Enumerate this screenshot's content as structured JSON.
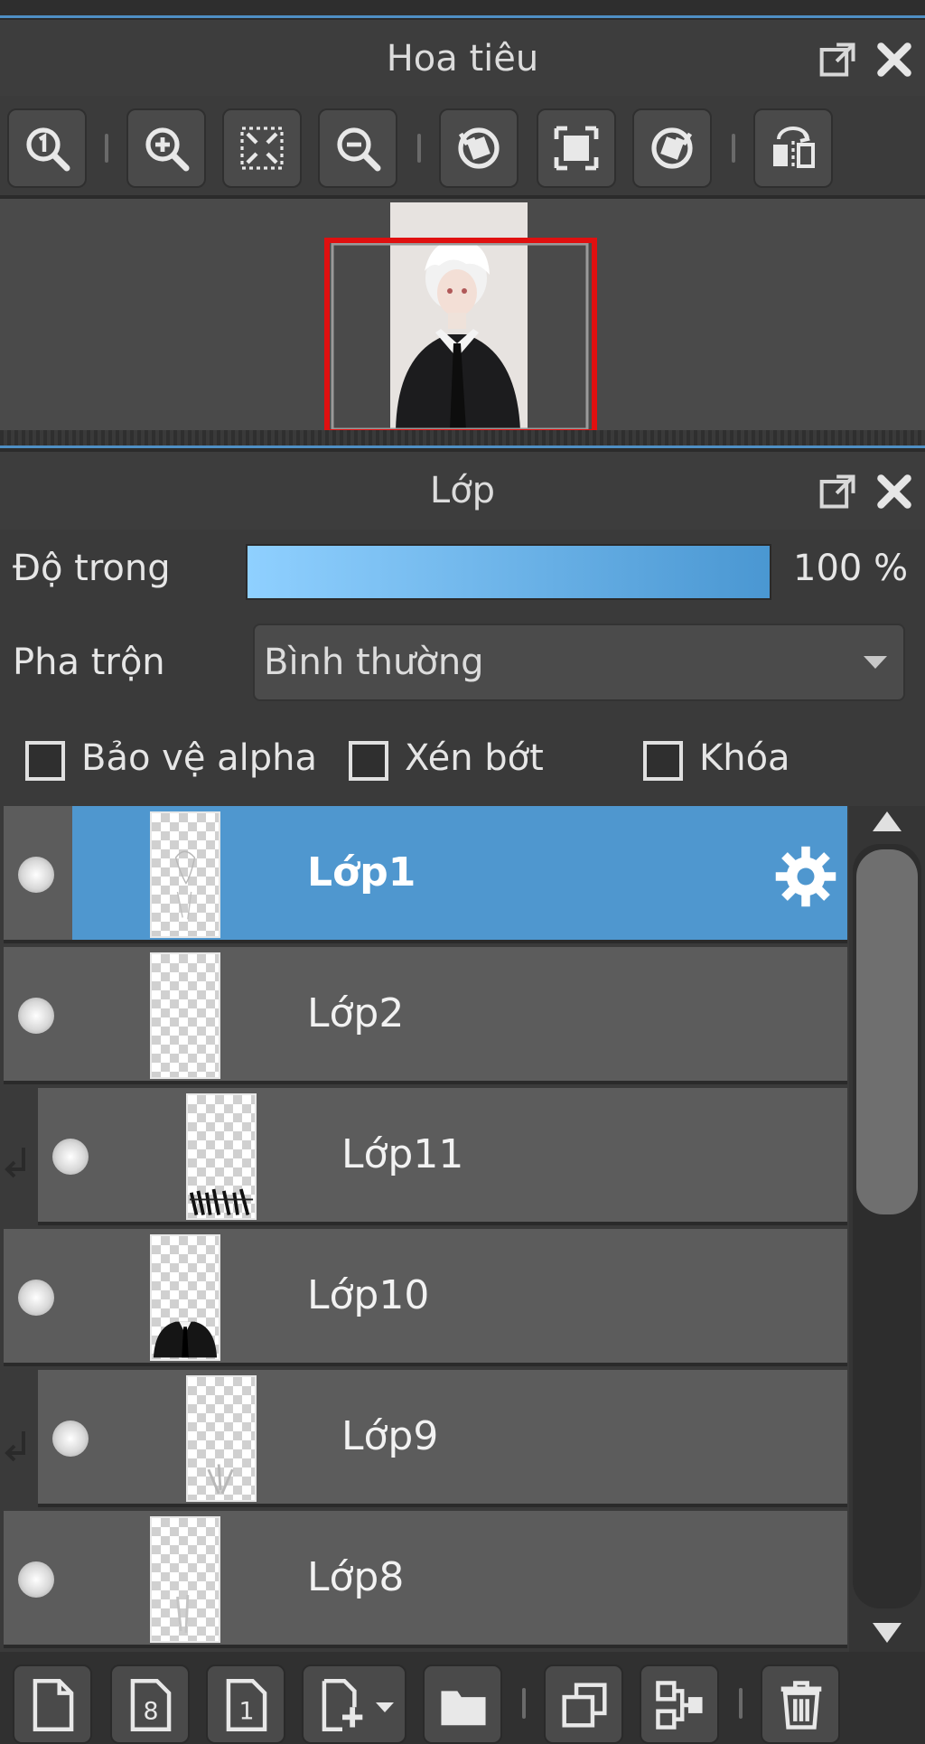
{
  "navigator": {
    "title": "Hoa tiêu",
    "toolbar": [
      {
        "name": "zoom-actual-size-icon"
      },
      {
        "name": "zoom-in-icon"
      },
      {
        "name": "fit-to-window-icon"
      },
      {
        "name": "zoom-out-icon"
      },
      {
        "name": "rotate-left-icon"
      },
      {
        "name": "fit-screen-icon"
      },
      {
        "name": "rotate-right-icon"
      },
      {
        "name": "flip-horizontal-icon"
      }
    ]
  },
  "layers_panel": {
    "title": "Lớp",
    "opacity_label": "Độ trong",
    "opacity_value": "100 %",
    "opacity_fraction": 1.0,
    "blend_label": "Pha trộn",
    "blend_mode": "Bình thường",
    "checkboxes": [
      {
        "label": "Bảo vệ alpha",
        "checked": false
      },
      {
        "label": "Xén bớt",
        "checked": false
      },
      {
        "label": "Khóa",
        "checked": false
      }
    ],
    "layers": [
      {
        "name": "Lớp1",
        "selected": true,
        "clipped": false
      },
      {
        "name": "Lớp2",
        "selected": false,
        "clipped": false
      },
      {
        "name": "Lớp11",
        "selected": false,
        "clipped": true
      },
      {
        "name": "Lớp10",
        "selected": false,
        "clipped": false
      },
      {
        "name": "Lớp9",
        "selected": false,
        "clipped": true
      },
      {
        "name": "Lớp8",
        "selected": false,
        "clipped": false
      }
    ],
    "bottom_toolbar": [
      {
        "name": "new-layer-icon"
      },
      {
        "name": "new-8bit-layer-icon"
      },
      {
        "name": "new-1bit-layer-icon"
      },
      {
        "name": "add-layer-dropdown-icon"
      },
      {
        "name": "new-folder-icon"
      },
      {
        "name": "duplicate-layer-icon"
      },
      {
        "name": "merge-down-icon"
      },
      {
        "name": "delete-layer-icon"
      }
    ]
  },
  "colors": {
    "accent": "#4f97cf",
    "viewport_frame": "#e01010",
    "panel_bg": "#3a3a3a",
    "row_bg": "#5c5c5c"
  }
}
